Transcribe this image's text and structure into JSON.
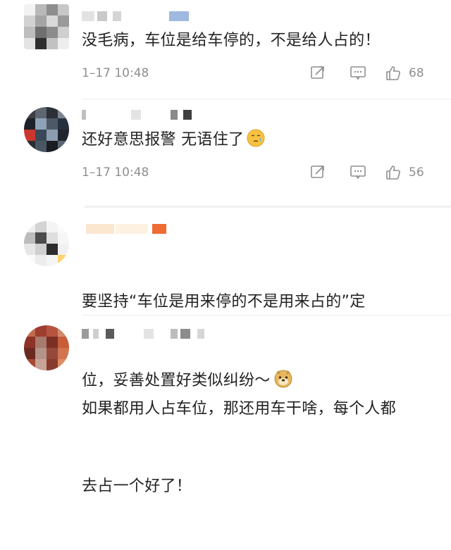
{
  "comments": [
    {
      "text": "没毛病，车位是给车停的，不是给人占的！",
      "time": "1–17 10:48",
      "like_count": "68"
    },
    {
      "text": "还好意思报警 无语住了",
      "emoji": "crying-face-emoji",
      "time": "1–17 10:48",
      "like_count": "56"
    },
    {
      "text_line1": "要坚持“车位是用来停的不是用来占的”定",
      "text_line2": "位，妥善处置好类似纠纷～",
      "emoji": "doge-emoji"
    },
    {
      "text_line1": "如果都用人占车位，那还用车干啥，每个人都",
      "text_line2": "去占一个好了！"
    }
  ],
  "icons": {
    "share": "share-icon",
    "reply": "comment-icon",
    "like": "thumbs-up-icon"
  },
  "colors": {
    "text": "#222222",
    "meta": "#8f8f8f",
    "divider": "#ececec",
    "background": "#ffffff"
  }
}
